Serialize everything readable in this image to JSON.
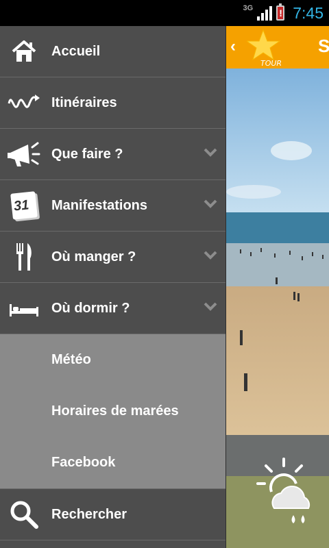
{
  "status_bar": {
    "network": "3G",
    "time": "7:45"
  },
  "header": {
    "title": "S"
  },
  "menu": {
    "items": [
      {
        "label": "Accueil",
        "icon": "home-icon"
      },
      {
        "label": "Itinéraires",
        "icon": "route-icon"
      },
      {
        "label": "Que faire ?",
        "icon": "megaphone-icon"
      },
      {
        "label": "Manifestations",
        "icon": "calendar-icon",
        "calendar_day": "31"
      },
      {
        "label": "Où manger ?",
        "icon": "fork-knife-icon"
      },
      {
        "label": "Où dormir ?",
        "icon": "bed-icon"
      }
    ],
    "sub_items": [
      {
        "label": "Météo"
      },
      {
        "label": "Horaires de marées"
      },
      {
        "label": "Facebook"
      }
    ],
    "search": {
      "label": "Rechercher",
      "icon": "search-icon"
    }
  },
  "colors": {
    "drawer_bg": "#4d4d4d",
    "sub_bg": "#8a8a8a",
    "header_orange": "#f5a100",
    "clock_blue": "#33b5e5"
  }
}
